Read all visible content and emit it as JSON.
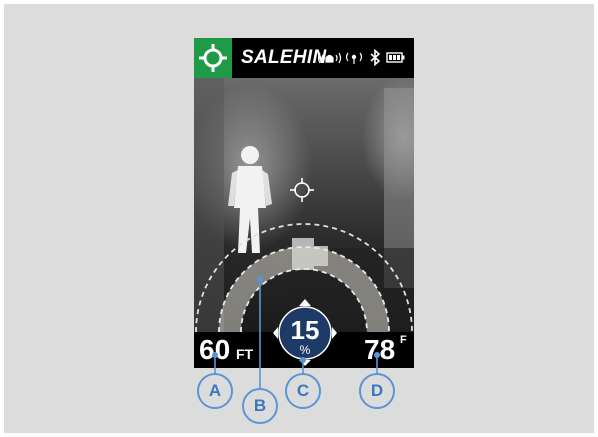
{
  "header": {
    "brand": "SALEHIN",
    "icons": [
      "crosshair-icon",
      "alarm-broadcast-icon",
      "wireless-signal-icon",
      "bluetooth-icon",
      "battery-icon"
    ]
  },
  "readouts": {
    "range_value": "60",
    "range_unit": "FT",
    "zoom_value": "15",
    "zoom_unit": "%",
    "temp_value": "78",
    "temp_unit": "F"
  },
  "callouts": {
    "a": "A",
    "b": "B",
    "c": "C",
    "d": "D"
  },
  "colors": {
    "accent_green": "#1f9a47",
    "callout_blue": "#5b95d6",
    "badge_navy": "#1e3a66"
  }
}
